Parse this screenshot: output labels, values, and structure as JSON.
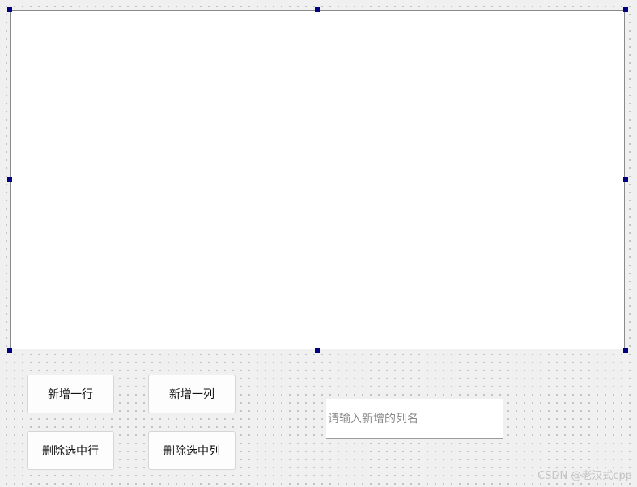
{
  "buttons": {
    "add_row": "新增一行",
    "add_column": "新增一列",
    "delete_row": "删除选中行",
    "delete_column": "删除选中列"
  },
  "column_name_input": {
    "value": "",
    "placeholder": "请输入新增的列名"
  },
  "watermark": "CSDN @老汉式cpp",
  "colors": {
    "canvas_background": "#f0f0f0",
    "selection_handle": "#000080",
    "table_background": "#ffffff"
  }
}
